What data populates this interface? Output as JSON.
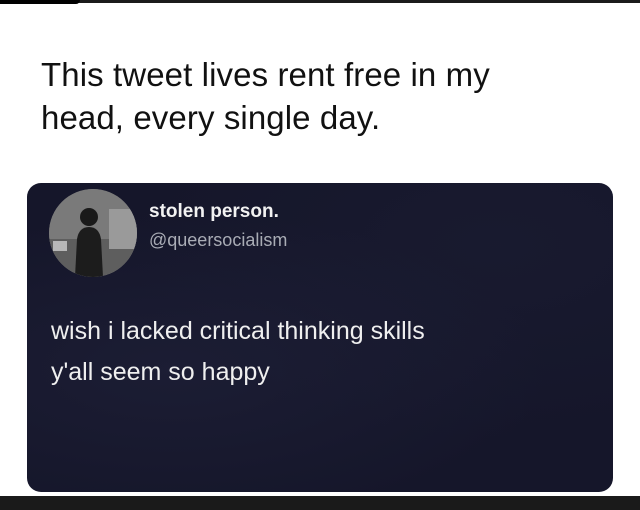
{
  "caption": {
    "line1": "This tweet lives rent free in my",
    "line2": "head, every single day."
  },
  "tweet": {
    "display_name": "stolen person.",
    "handle": "@queersocialism",
    "text_line1": "wish i lacked critical thinking skills",
    "text_line2": "y'all seem so happy",
    "avatar_icon": "user-silhouette-avatar"
  },
  "colors": {
    "page_background": "#ffffff",
    "tweet_background": "#15162a",
    "tweet_text": "#efefef",
    "handle_text": "#a9acb5"
  }
}
